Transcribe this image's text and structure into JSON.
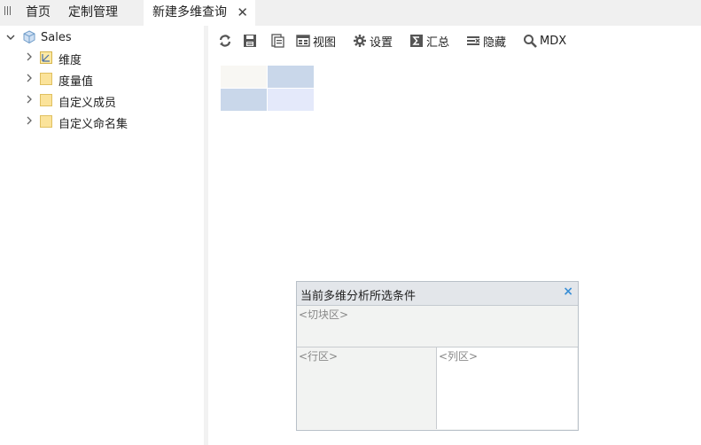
{
  "tabs": {
    "home": "首页",
    "custom": "定制管理",
    "active": "新建多维查询",
    "close_glyph": "✕"
  },
  "tree": {
    "root": "Sales",
    "items": [
      {
        "label": "维度",
        "icon": "dimension-icon"
      },
      {
        "label": "度量值",
        "icon": "folder-icon"
      },
      {
        "label": "自定义成员",
        "icon": "folder-icon"
      },
      {
        "label": "自定义命名集",
        "icon": "folder-icon"
      }
    ]
  },
  "toolbar": {
    "refresh": "refresh-icon",
    "save": "save-icon",
    "save_as": "save-as-icon",
    "view": "视图",
    "settings": "设置",
    "summary": "汇总",
    "hide": "隐藏",
    "mdx": "MDX"
  },
  "conditions": {
    "title": "当前多维分析所选条件",
    "close_glyph": "×",
    "slice": "<切块区>",
    "rows": "<行区>",
    "cols": "<列区>"
  },
  "colors": {
    "accent": "#3a8fd6",
    "grid_corner": "#f8f7f3",
    "grid_header": "#c9d7ea",
    "grid_data": "#e4e9fa"
  }
}
